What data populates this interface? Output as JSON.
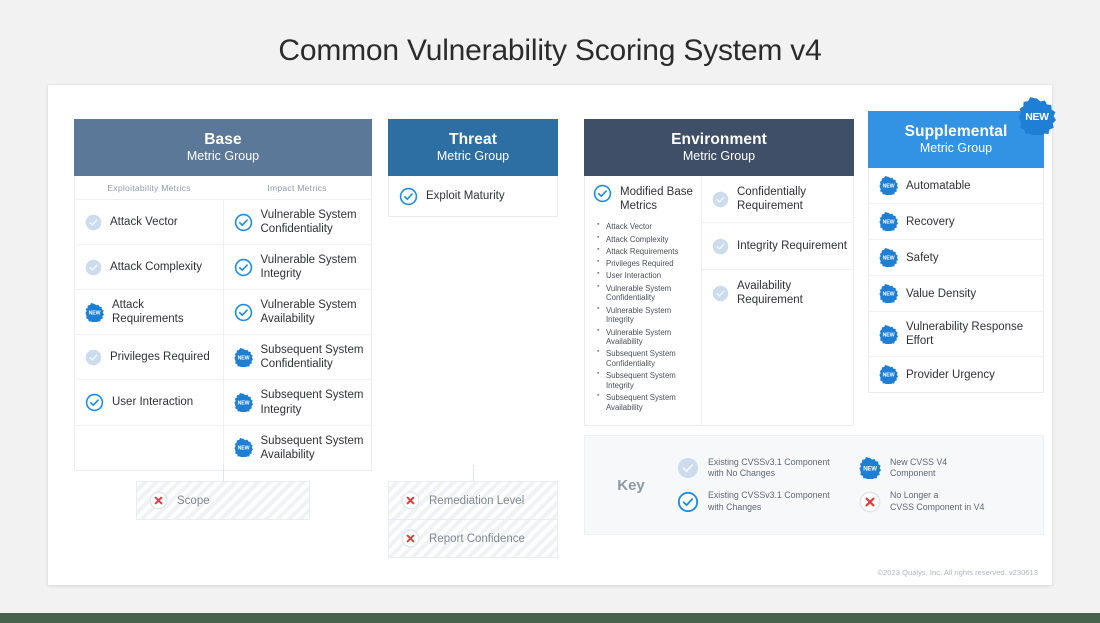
{
  "page": {
    "title": "Common Vulnerability Scoring System v4",
    "copyright": "©2023 Qualys, Inc. All rights reserved. v230613",
    "background_color": "#f2f2f2",
    "accent_bar_color": "#47634c"
  },
  "colors": {
    "base_header": "#5c7899",
    "threat_header": "#2d6fa3",
    "environment_header": "#3f4f68",
    "supplemental_header": "#3292e3",
    "new_badge": "#1f7fd4",
    "check_changed": "#1b8ce3",
    "check_unchanged": "#c3d4e2",
    "removed_x": "#e23b3b"
  },
  "groups": {
    "base": {
      "name": "Base",
      "subtitle": "Metric Group",
      "subheads": [
        "Exploitability Metrics",
        "Impact Metrics"
      ],
      "rows": [
        {
          "left": {
            "label": "Attack Vector",
            "icon": "check-unchanged-icon"
          },
          "right": {
            "label": "Vulnerable System Confidentiality",
            "icon": "check-changed-icon"
          }
        },
        {
          "left": {
            "label": "Attack Complexity",
            "icon": "check-unchanged-icon"
          },
          "right": {
            "label": "Vulnerable System Integrity",
            "icon": "check-changed-icon"
          }
        },
        {
          "left": {
            "label": "Attack Requirements",
            "icon": "new-badge-icon"
          },
          "right": {
            "label": "Vulnerable System Availability",
            "icon": "check-changed-icon"
          }
        },
        {
          "left": {
            "label": "Privileges Required",
            "icon": "check-unchanged-icon"
          },
          "right": {
            "label": "Subsequent System Confidentiality",
            "icon": "new-badge-icon"
          }
        },
        {
          "left": {
            "label": "User Interaction",
            "icon": "check-changed-icon"
          },
          "right": {
            "label": "Subsequent System Integrity",
            "icon": "new-badge-icon"
          }
        },
        {
          "left": {
            "label": "",
            "icon": "none"
          },
          "right": {
            "label": "Subsequent System Availability",
            "icon": "new-badge-icon"
          }
        }
      ],
      "removed": [
        {
          "label": "Scope",
          "icon": "removed-x-icon"
        }
      ]
    },
    "threat": {
      "name": "Threat",
      "subtitle": "Metric Group",
      "rows": [
        {
          "label": "Exploit Maturity",
          "icon": "check-changed-icon"
        }
      ],
      "removed": [
        {
          "label": "Remediation Level",
          "icon": "removed-x-icon"
        },
        {
          "label": "Report Confidence",
          "icon": "removed-x-icon"
        }
      ]
    },
    "environment": {
      "name": "Environment",
      "subtitle": "Metric Group",
      "modified": {
        "label": "Modified Base Metrics",
        "icon": "check-changed-icon",
        "bullets": [
          "Attack Vector",
          "Attack Complexity",
          "Attack Requirements",
          "Privileges Required",
          "User Interaction",
          "Vulnerable System Confidentiality",
          "Vulnerable System Integrity",
          "Vulnerable System Availability",
          "Subsequent System Confidentiality",
          "Subsequent System Integrity",
          "Subsequent System Availability"
        ]
      },
      "requirements": [
        {
          "label": "Confidentially Requirement",
          "icon": "check-unchanged-icon"
        },
        {
          "label": "Integrity Requirement",
          "icon": "check-unchanged-icon"
        },
        {
          "label": "Availability Requirement",
          "icon": "check-unchanged-icon"
        }
      ]
    },
    "supplemental": {
      "name": "Supplemental",
      "subtitle": "Metric Group",
      "badge": "NEW",
      "rows": [
        {
          "label": "Automatable",
          "icon": "new-badge-icon"
        },
        {
          "label": "Recovery",
          "icon": "new-badge-icon"
        },
        {
          "label": "Safety",
          "icon": "new-badge-icon"
        },
        {
          "label": "Value Density",
          "icon": "new-badge-icon"
        },
        {
          "label": "Vulnerability Response Effort",
          "icon": "new-badge-icon"
        },
        {
          "label": "Provider Urgency",
          "icon": "new-badge-icon"
        }
      ]
    }
  },
  "key": {
    "title": "Key",
    "items": [
      {
        "icon": "check-unchanged-icon",
        "line1": "Existing CVSSv3.1 Component",
        "line2": "with No Changes"
      },
      {
        "icon": "new-badge-icon",
        "line1": "New CVSS V4",
        "line2": "Component"
      },
      {
        "icon": "check-changed-icon",
        "line1": "Existing CVSSv3.1 Component",
        "line2": "with Changes"
      },
      {
        "icon": "removed-x-icon",
        "line1": "No Longer a",
        "line2": "CVSS Component in V4"
      }
    ]
  }
}
